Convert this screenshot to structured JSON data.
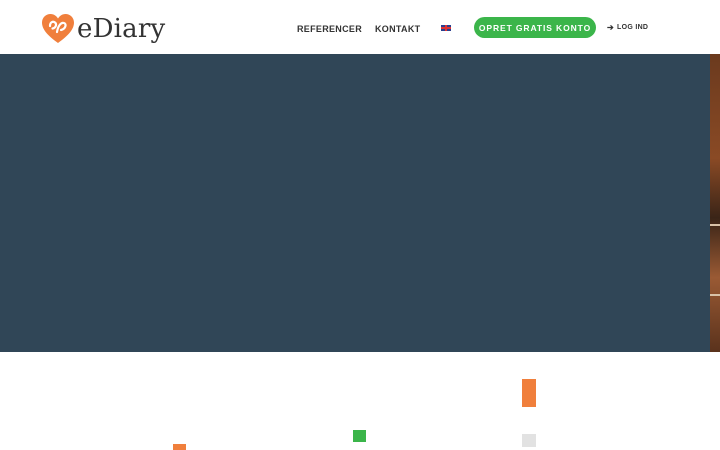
{
  "header": {
    "logo_text": "eDiary",
    "nav": [
      {
        "label": "REFERENCER"
      },
      {
        "label": "KONTAKT"
      }
    ],
    "language_flag": "uk-flag-icon",
    "cta_label": "OPRET GRATIS KONTO",
    "login_label": "LOG IND",
    "login_icon": "arrow-right-icon"
  },
  "colors": {
    "brand_orange": "#f07f3c",
    "cta_green": "#3bb54a",
    "hero_bg": "#304657",
    "text_dark": "#333333",
    "deco_gray": "#e2e2e2"
  }
}
